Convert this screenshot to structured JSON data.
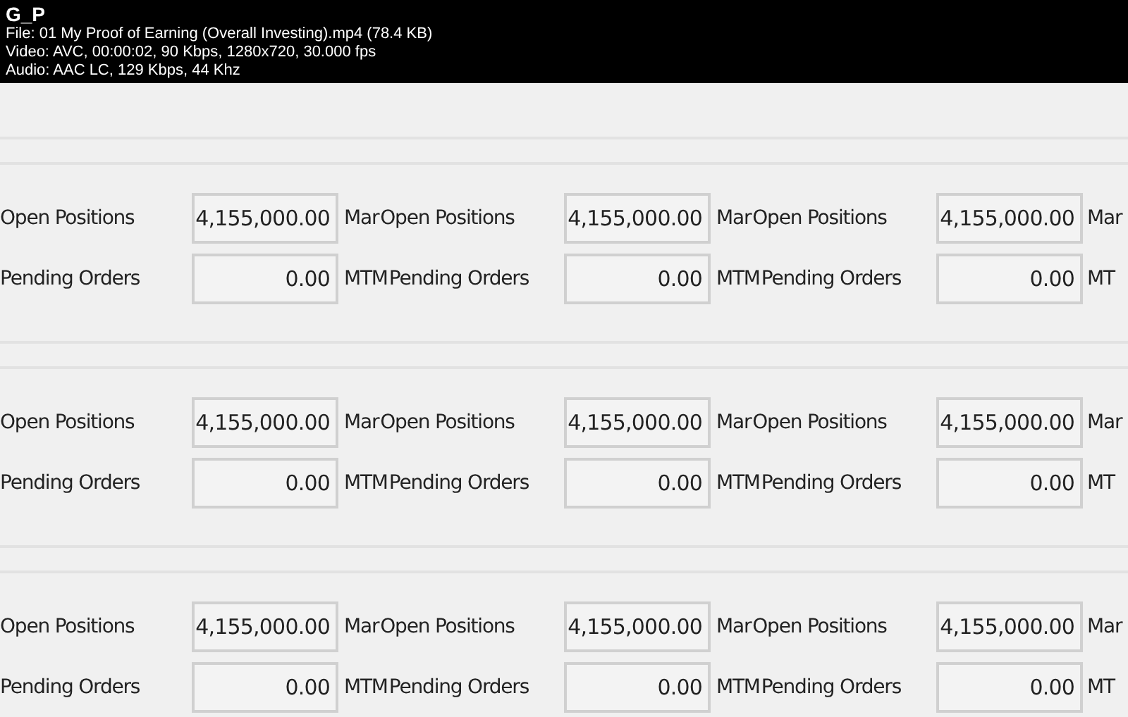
{
  "video_info": {
    "title": "G_P",
    "lines": [
      "File: 01   My Proof of Earning (Overall Investing).mp4 (78.4 KB)",
      "Video: AVC, 00:00:02, 90 Kbps, 1280x720, 30.000 fps",
      "Audio: AAC LC, 129 Kbps, 44 Khz"
    ]
  },
  "sections": [
    {
      "rows": [
        {
          "cells": [
            {
              "label": "Open Positions",
              "value": "4,155,000.00"
            },
            {
              "prefix": "Mar",
              "label": "Open Positions",
              "value": "4,155,000.00"
            },
            {
              "prefix": "Mar",
              "label": "Open Positions",
              "value": "4,155,000.00"
            }
          ],
          "trailing": "Mar"
        },
        {
          "cells": [
            {
              "label": "Pending Orders",
              "value": "0.00"
            },
            {
              "prefix": "MTM",
              "label": "Pending Orders",
              "value": "0.00"
            },
            {
              "prefix": "MTM",
              "label": "Pending Orders",
              "value": "0.00"
            }
          ],
          "trailing": "MT"
        }
      ]
    },
    {
      "rows": [
        {
          "cells": [
            {
              "label": "Open Positions",
              "value": "4,155,000.00"
            },
            {
              "prefix": "Mar",
              "label": "Open Positions",
              "value": "4,155,000.00"
            },
            {
              "prefix": "Mar",
              "label": "Open Positions",
              "value": "4,155,000.00"
            }
          ],
          "trailing": "Mar"
        },
        {
          "cells": [
            {
              "label": "Pending Orders",
              "value": "0.00"
            },
            {
              "prefix": "MTM",
              "label": "Pending Orders",
              "value": "0.00"
            },
            {
              "prefix": "MTM",
              "label": "Pending Orders",
              "value": "0.00"
            }
          ],
          "trailing": "MT"
        }
      ]
    },
    {
      "rows": [
        {
          "cells": [
            {
              "label": "Open Positions",
              "value": "4,155,000.00"
            },
            {
              "prefix": "Mar",
              "label": "Open Positions",
              "value": "4,155,000.00"
            },
            {
              "prefix": "Mar",
              "label": "Open Positions",
              "value": "4,155,000.00"
            }
          ],
          "trailing": "Mar"
        },
        {
          "cells": [
            {
              "label": "Pending Orders",
              "value": "0.00"
            },
            {
              "prefix": "MTM",
              "label": "Pending Orders",
              "value": "0.00"
            },
            {
              "prefix": "MTM",
              "label": "Pending Orders",
              "value": "0.00"
            }
          ],
          "trailing": "MT"
        }
      ]
    }
  ]
}
